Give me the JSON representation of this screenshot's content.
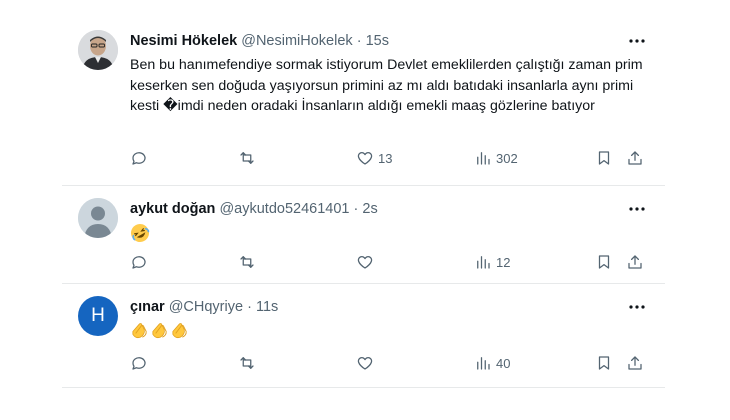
{
  "tweets": [
    {
      "name": "Nesimi Hökelek",
      "handle": "@NesimiHokelek",
      "separator": "·",
      "time": "15s",
      "text": "Ben bu hanımefendiye sormak istiyorum Devlet emeklilerden çalıştığı zaman prim keserken sen doğuda yaşıyorsun primini az mı aldı batıdaki insanlarla aynı primi kesti �imdi neden oradaki İnsanların aldığı emekli maaş gözlerine batıyor",
      "avatar_icon": "person-photo-icon",
      "likes": "13",
      "views": "302"
    },
    {
      "name": "aykut doğan",
      "handle": "@aykutdo52461401",
      "separator": "·",
      "time": "2s",
      "emoji": "laughing-rolling-emoji",
      "avatar_icon": "default-person-icon",
      "views": "12"
    },
    {
      "name": "çınar",
      "handle": "@CHqyriye",
      "separator": "·",
      "time": "11s",
      "emoji": "clapping-hands-emoji x3",
      "avatar_letter": "H",
      "avatar_color": "#1565c0",
      "views": "40"
    }
  ],
  "colors": {
    "text": "#0f1419",
    "secondary": "#536471",
    "border": "#e7e9ea"
  }
}
